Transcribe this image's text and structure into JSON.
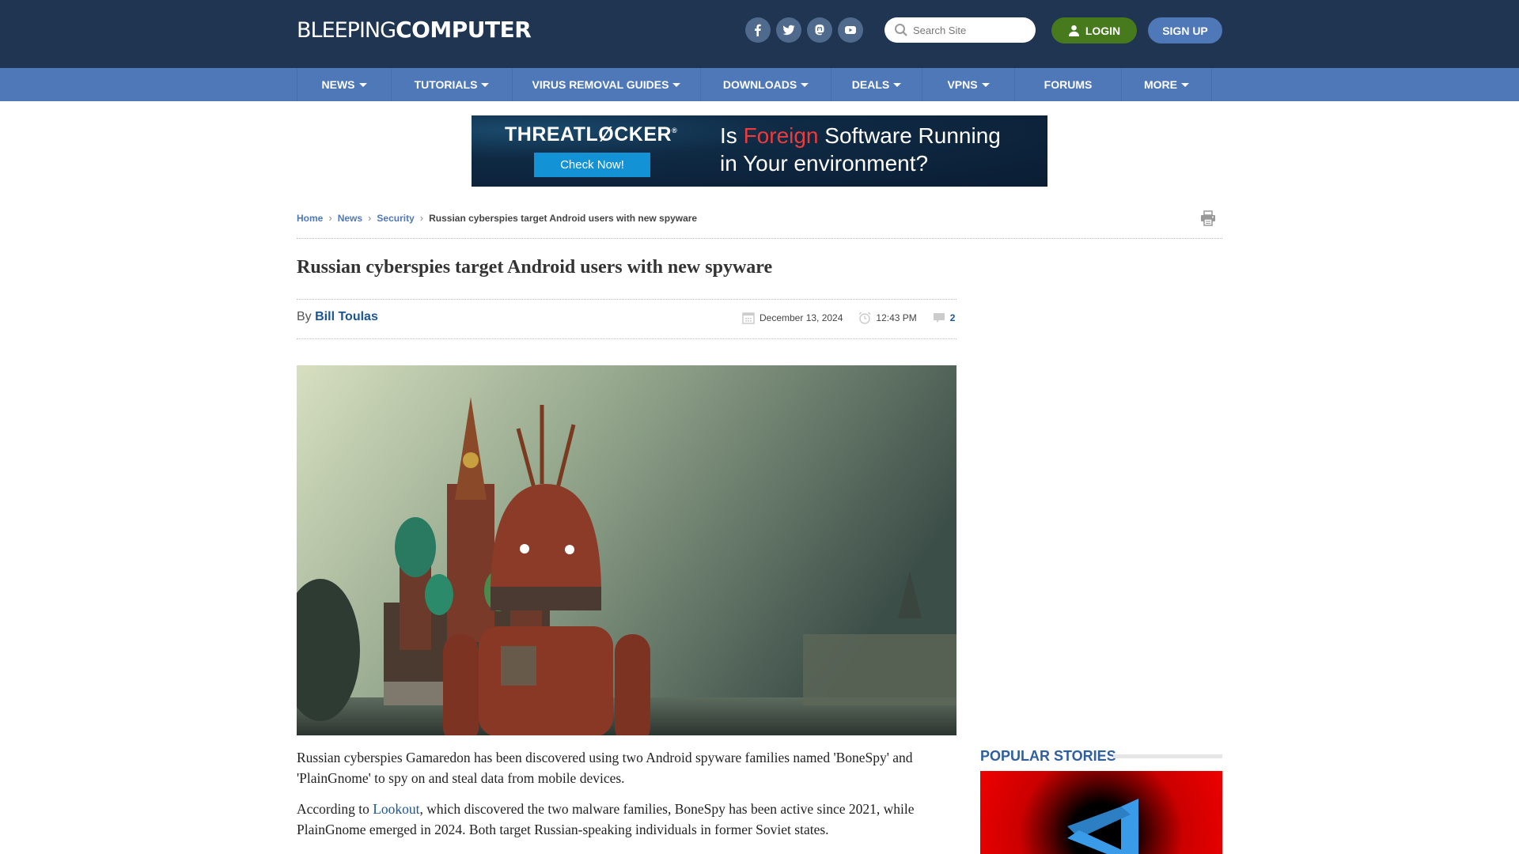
{
  "header": {
    "logo_thin": "BLEEPING",
    "logo_bold": "COMPUTER",
    "social": [
      {
        "name": "facebook",
        "icon": "facebook-icon"
      },
      {
        "name": "twitter",
        "icon": "twitter-icon"
      },
      {
        "name": "mastodon",
        "icon": "mastodon-icon"
      },
      {
        "name": "youtube",
        "icon": "youtube-icon"
      }
    ],
    "search_placeholder": "Search Site",
    "login_label": "LOGIN",
    "signup_label": "SIGN UP"
  },
  "nav": {
    "items": [
      {
        "label": "NEWS",
        "dropdown": true
      },
      {
        "label": "TUTORIALS",
        "dropdown": true
      },
      {
        "label": "VIRUS REMOVAL GUIDES",
        "dropdown": true
      },
      {
        "label": "DOWNLOADS",
        "dropdown": true
      },
      {
        "label": "DEALS",
        "dropdown": true
      },
      {
        "label": "VPNS",
        "dropdown": true
      },
      {
        "label": "FORUMS",
        "dropdown": false
      },
      {
        "label": "MORE",
        "dropdown": true
      }
    ]
  },
  "ad": {
    "brand": "THREATLØCKER",
    "registered": "®",
    "button": "Check Now!",
    "line1_pre": "Is ",
    "line1_highlight": "Foreign",
    "line1_post": " Software Running",
    "line2": "in Your environment?",
    "highlight_color": "#ee3a3a"
  },
  "breadcrumb": {
    "items": [
      "Home",
      "News",
      "Security"
    ],
    "current": "Russian cyberspies target Android users with new spyware"
  },
  "article": {
    "title": "Russian cyberspies target Android users with new spyware",
    "by_label": "By",
    "author": "Bill Toulas",
    "date": "December 13, 2024",
    "time": "12:43 PM",
    "comments": "2",
    "paragraphs": [
      {
        "text": "Russian cyberspies Gamaredon has been discovered using two Android spyware families named 'BoneSpy' and 'PlainGnome' to spy on and steal data from mobile devices."
      },
      {
        "pre": "According to ",
        "link": "Lookout",
        "post": ", which discovered the two malware families, BoneSpy has been active since 2021, while PlainGnome emerged in 2024. Both target Russian-speaking individuals in former Soviet states."
      }
    ]
  },
  "sidebar": {
    "popular_heading": "POPULAR STORIES"
  },
  "colors": {
    "header_bg": "#1f3552",
    "nav_bg": "#4f78b8",
    "login_bg": "#467a1d",
    "link": "#1a5594"
  }
}
